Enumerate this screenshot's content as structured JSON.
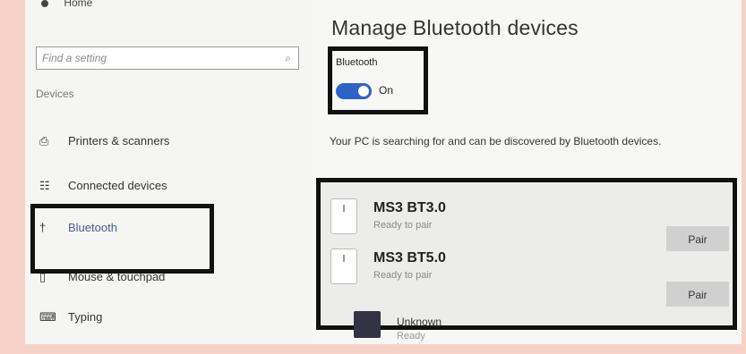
{
  "sidebar": {
    "home_label": "Home",
    "search_placeholder": "Find a setting",
    "section_label": "Devices",
    "items": [
      {
        "label": "Printers & scanners"
      },
      {
        "label": "Connected devices"
      },
      {
        "label": "Bluetooth"
      },
      {
        "label": "Mouse & touchpad"
      },
      {
        "label": "Typing"
      }
    ]
  },
  "main": {
    "title": "Manage Bluetooth devices",
    "bluetooth_label": "Bluetooth",
    "toggle_state": "On",
    "status_text": "Your PC is searching for and can be discovered by Bluetooth devices.",
    "devices": [
      {
        "name": "MS3 BT3.0",
        "status": "Ready to pair",
        "button": "Pair"
      },
      {
        "name": "MS3 BT5.0",
        "status": "Ready to pair",
        "button": "Pair"
      },
      {
        "name": "Unknown",
        "status": "Ready to pair"
      }
    ]
  },
  "colors": {
    "background": "#f6d2c6",
    "toggle_on": "#2d63c8",
    "highlight_border": "#111111",
    "selected_nav": "#4b5f8a"
  },
  "icons": [
    "search-icon",
    "printer-icon",
    "connected-devices-icon",
    "bluetooth-icon",
    "mouse-icon",
    "keyboard-icon",
    "device-icon"
  ]
}
